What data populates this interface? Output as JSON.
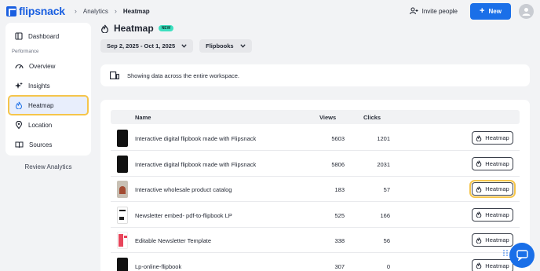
{
  "header": {
    "logo_text": "flipsnack",
    "breadcrumb": [
      "Analytics",
      "Heatmap"
    ],
    "invite_label": "Invite people",
    "new_label": "New"
  },
  "sidebar": {
    "dashboard": "Dashboard",
    "section_label": "Performance",
    "items": [
      "Overview",
      "Insights",
      "Heatmap",
      "Location",
      "Sources"
    ],
    "active": "Heatmap",
    "review_label": "Review Analytics"
  },
  "main": {
    "title": "Heatmap",
    "badge": "NEW",
    "date_range": "Sep 2, 2025 - Oct 1, 2025",
    "type_filter": "Flipbooks",
    "notice": "Showing data across the entire workspace."
  },
  "table": {
    "columns": {
      "name": "Name",
      "views": "Views",
      "clicks": "Clicks"
    },
    "button_label": "Heatmap",
    "rows": [
      {
        "name": "Interactive digital flipbook made with Flipsnack",
        "views": "5603",
        "clicks": "1201",
        "thumb": "dark"
      },
      {
        "name": "Interactive digital flipbook made with Flipsnack",
        "views": "5806",
        "clicks": "2031",
        "thumb": "dark"
      },
      {
        "name": "Interactive wholesale product catalog",
        "views": "183",
        "clicks": "57",
        "thumb": "catalog"
      },
      {
        "name": "Newsletter embed- pdf-to-flipbook LP",
        "views": "525",
        "clicks": "166",
        "thumb": "newsletter"
      },
      {
        "name": "Editable Newsletter Template",
        "views": "338",
        "clicks": "56",
        "thumb": "template"
      },
      {
        "name": "Lp-online-flipbook",
        "views": "307",
        "clicks": "0",
        "thumb": "dark"
      }
    ]
  },
  "colors": {
    "accent": "#1a6fe8",
    "highlight": "#f5c54b",
    "badge": "#3de0c0"
  },
  "icons": [
    "flipsnack-logo-icon",
    "invite-people-icon",
    "plus-icon",
    "avatar-icon",
    "dashboard-icon",
    "overview-icon",
    "insights-icon",
    "heatmap-icon",
    "location-icon",
    "sources-icon",
    "chevron-down-icon",
    "workspace-icon",
    "chat-icon"
  ]
}
